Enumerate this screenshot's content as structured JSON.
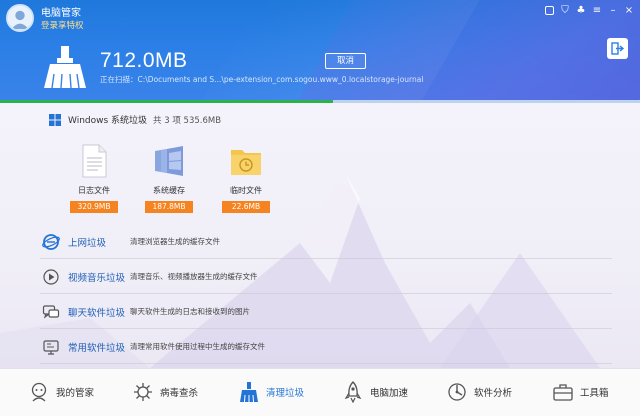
{
  "app": {
    "title": "电脑管家",
    "vip_link": "登录享特权"
  },
  "scan": {
    "size": "712.0MB",
    "status": "正在扫描：C:\\Documents and S...\\pe-extension_com.sogou.www_0.localstorage-journal",
    "cancel_label": "取消",
    "progress": 0.52
  },
  "windows_section": {
    "title": "Windows 系统垃圾",
    "summary": "共 3 项  535.6MB"
  },
  "files": [
    {
      "label": "日志文件",
      "size": "320.9MB",
      "icon": "document-icon"
    },
    {
      "label": "系统缓存",
      "size": "187.8MB",
      "icon": "windows-cache-icon"
    },
    {
      "label": "临时文件",
      "size": "22.6MB",
      "icon": "folder-clock-icon"
    }
  ],
  "categories": [
    {
      "title": "上网垃圾",
      "desc": "清理浏览器生成的缓存文件",
      "icon": "ie-icon"
    },
    {
      "title": "视频音乐垃圾",
      "desc": "清理音乐、视频播放器生成的缓存文件",
      "icon": "play-icon"
    },
    {
      "title": "聊天软件垃圾",
      "desc": "聊天软件生成的日志和接收到的图片",
      "icon": "chat-icon"
    },
    {
      "title": "常用软件垃圾",
      "desc": "清理常用软件使用过程中生成的缓存文件",
      "icon": "software-icon"
    }
  ],
  "nav": [
    {
      "label": "我的管家",
      "icon": "butler-icon",
      "active": false
    },
    {
      "label": "病毒查杀",
      "icon": "virus-icon",
      "active": false
    },
    {
      "label": "清理垃圾",
      "icon": "broom-icon",
      "active": true
    },
    {
      "label": "电脑加速",
      "icon": "rocket-icon",
      "active": false
    },
    {
      "label": "软件分析",
      "icon": "analysis-icon",
      "active": false
    },
    {
      "label": "工具箱",
      "icon": "toolbox-icon",
      "active": false
    }
  ],
  "colors": {
    "accent": "#2b7fe6",
    "orange": "#f5831f",
    "progress": "#2bb24c",
    "link": "#1f5fb5"
  }
}
